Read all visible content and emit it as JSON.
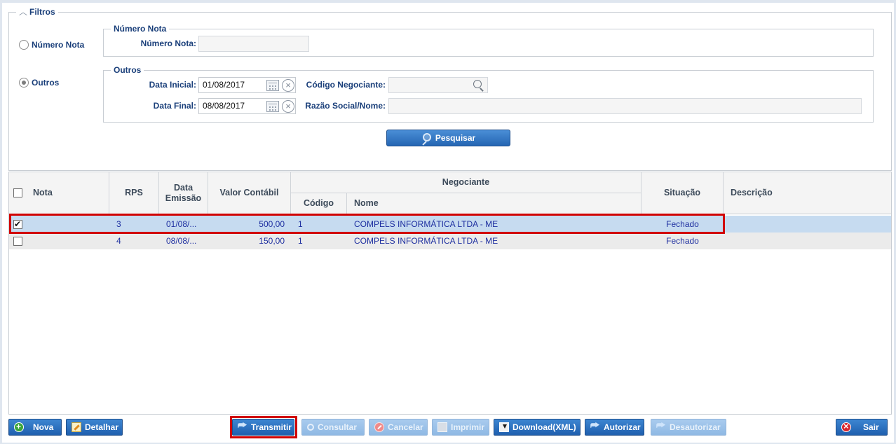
{
  "filters": {
    "legend": "Filtros",
    "radio_numero_nota": "Número Nota",
    "radio_outros": "Outros",
    "numero_nota_group": {
      "legend": "Número Nota",
      "label": "Número Nota:",
      "value": ""
    },
    "outros_group": {
      "legend": "Outros",
      "data_inicial_label": "Data Inicial:",
      "data_inicial_value": "01/08/2017",
      "data_final_label": "Data Final:",
      "data_final_value": "08/08/2017",
      "codigo_negociante_label": "Código Negociante:",
      "codigo_negociante_value": "",
      "razao_social_label": "Razão Social/Nome:",
      "razao_social_value": ""
    },
    "search_button": "Pesquisar",
    "selected": "Outros"
  },
  "grid": {
    "headers": {
      "nota": "Nota",
      "rps": "RPS",
      "data_emissao": "Data Emissão",
      "valor_contabil": "Valor Contábil",
      "negociante": "Negociante",
      "codigo": "Código",
      "nome": "Nome",
      "situacao": "Situação",
      "descricao": "Descrição"
    },
    "rows": [
      {
        "checked": true,
        "nota": "",
        "rps": "3",
        "data_emissao": "01/08/...",
        "valor": "500,00",
        "codigo": "1",
        "nome": "COMPELS INFORMÁTICA LTDA - ME",
        "situacao": "Fechado",
        "descricao": ""
      },
      {
        "checked": false,
        "nota": "",
        "rps": "4",
        "data_emissao": "08/08/...",
        "valor": "150,00",
        "codigo": "1",
        "nome": "COMPELS INFORMÁTICA LTDA - ME",
        "situacao": "Fechado",
        "descricao": ""
      }
    ]
  },
  "toolbar": {
    "nova": "Nova",
    "detalhar": "Detalhar",
    "transmitir": "Transmitir",
    "consultar": "Consultar",
    "cancelar": "Cancelar",
    "imprimir": "Imprimir",
    "download_xml": "Download(XML)",
    "autorizar": "Autorizar",
    "desautorizar": "Desautorizar",
    "sair": "Sair"
  },
  "colors": {
    "accent": "#2566b3",
    "selected_row": "#c6dbf0",
    "highlight": "#d10000",
    "link_text": "#1e2fa0"
  }
}
